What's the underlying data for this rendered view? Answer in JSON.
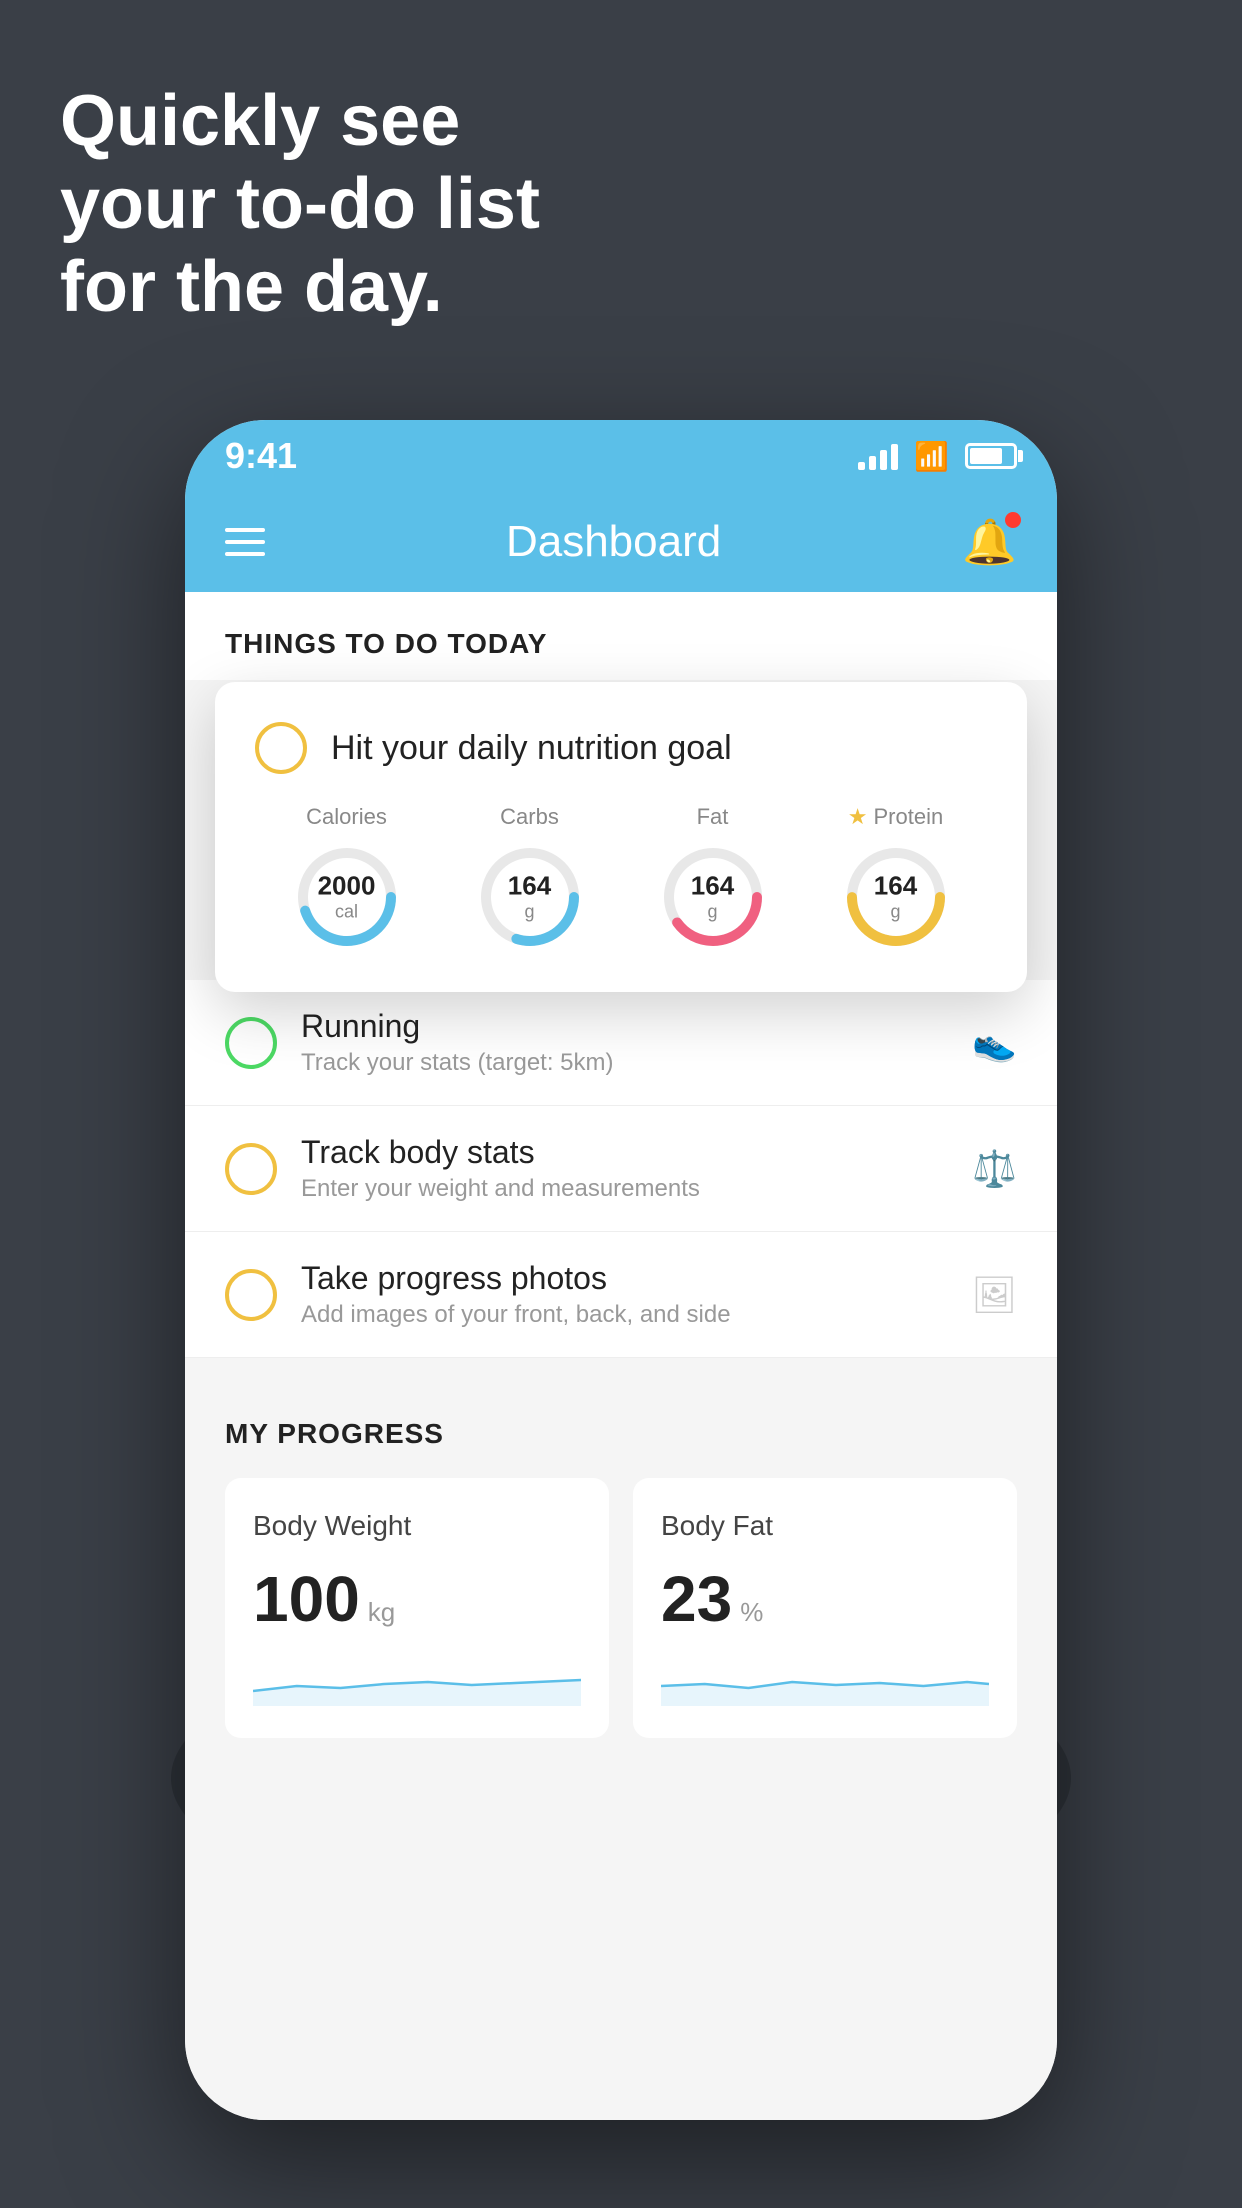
{
  "background_color": "#3a3f47",
  "hero": {
    "line1": "Quickly see",
    "line2": "your to-do list",
    "line3": "for the day."
  },
  "phone": {
    "status_bar": {
      "time": "9:41",
      "signal_label": "signal-bars",
      "wifi_label": "wifi-icon",
      "battery_label": "battery-icon"
    },
    "nav": {
      "title": "Dashboard",
      "hamburger_label": "menu-icon",
      "bell_label": "bell-icon"
    },
    "section_header": "THINGS TO DO TODAY",
    "todo_popup": {
      "main_item": {
        "title": "Hit your daily nutrition goal",
        "checked": false
      },
      "nutrition": [
        {
          "label": "Calories",
          "value": "2000",
          "unit": "cal",
          "color": "#5bbfe8",
          "track_pct": 70
        },
        {
          "label": "Carbs",
          "value": "164",
          "unit": "g",
          "color": "#5bbfe8",
          "track_pct": 55
        },
        {
          "label": "Fat",
          "value": "164",
          "unit": "g",
          "color": "#f06080",
          "track_pct": 65
        },
        {
          "label": "Protein",
          "value": "164",
          "unit": "g",
          "color": "#f0c040",
          "track_pct": 75,
          "star": true
        }
      ]
    },
    "todo_items": [
      {
        "title": "Running",
        "subtitle": "Track your stats (target: 5km)",
        "checked": true,
        "icon": "shoe-icon"
      },
      {
        "title": "Track body stats",
        "subtitle": "Enter your weight and measurements",
        "checked": false,
        "icon": "scale-icon"
      },
      {
        "title": "Take progress photos",
        "subtitle": "Add images of your front, back, and side",
        "checked": false,
        "icon": "photo-icon"
      }
    ],
    "progress": {
      "header": "MY PROGRESS",
      "cards": [
        {
          "title": "Body Weight",
          "value": "100",
          "unit": "kg"
        },
        {
          "title": "Body Fat",
          "value": "23",
          "unit": "%"
        }
      ]
    }
  }
}
